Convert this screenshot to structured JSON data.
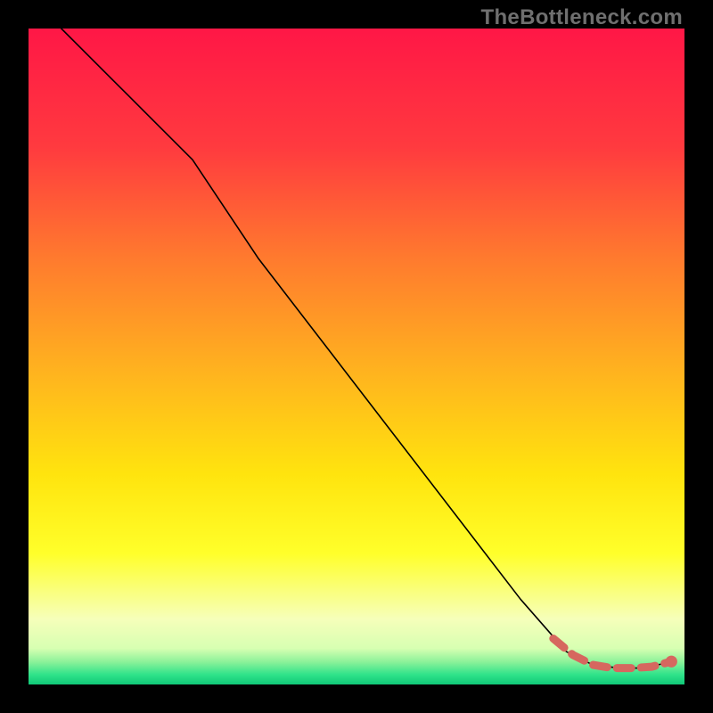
{
  "watermark": "TheBottleneck.com",
  "chart_data": {
    "type": "line",
    "title": "",
    "xlabel": "",
    "ylabel": "",
    "xlim": [
      0,
      100
    ],
    "ylim": [
      0,
      100
    ],
    "grid": false,
    "legend": false,
    "series": [
      {
        "name": "curve",
        "style": "solid",
        "color": "#000000",
        "x": [
          5,
          15,
          25,
          35,
          45,
          55,
          65,
          75,
          82,
          86,
          90,
          94,
          98
        ],
        "y": [
          100,
          90,
          80,
          65,
          52,
          39,
          26,
          13,
          5,
          3,
          2.5,
          2.5,
          3.5
        ]
      },
      {
        "name": "highlight",
        "style": "dashed-thick",
        "color": "#d6675f",
        "x": [
          80,
          83,
          86,
          89,
          92,
          95,
          98
        ],
        "y": [
          7,
          4.5,
          3,
          2.5,
          2.5,
          2.7,
          3.5
        ]
      }
    ],
    "points": [
      {
        "x": 98,
        "y": 3.5,
        "color": "#d6675f"
      }
    ],
    "background_gradient": {
      "stops": [
        {
          "pos": 0.0,
          "color": "#ff1746"
        },
        {
          "pos": 0.18,
          "color": "#ff3a3f"
        },
        {
          "pos": 0.35,
          "color": "#ff7a2e"
        },
        {
          "pos": 0.52,
          "color": "#ffb21f"
        },
        {
          "pos": 0.68,
          "color": "#ffe40e"
        },
        {
          "pos": 0.8,
          "color": "#ffff2a"
        },
        {
          "pos": 0.9,
          "color": "#f6ffba"
        },
        {
          "pos": 0.945,
          "color": "#d7ffb2"
        },
        {
          "pos": 0.965,
          "color": "#8ef29a"
        },
        {
          "pos": 0.985,
          "color": "#2fe38a"
        },
        {
          "pos": 1.0,
          "color": "#10c877"
        }
      ]
    }
  }
}
